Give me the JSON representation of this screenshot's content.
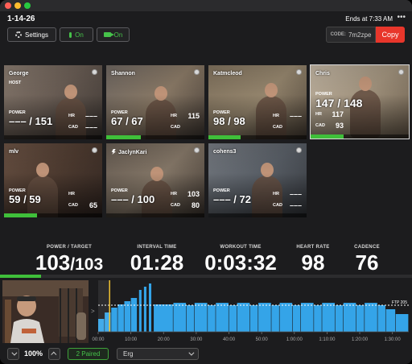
{
  "session": {
    "id": "1-14-26",
    "ends_at": "Ends at 7:33 AM",
    "more_label": "•••"
  },
  "toolbar": {
    "settings_label": "Settings",
    "mic_label": "On",
    "camera_label": "On",
    "code_label": "CODE:",
    "code_value": "7m2zpe",
    "copy_label": "Copy"
  },
  "labels": {
    "power": "POWER",
    "hr": "HR",
    "cad": "CAD",
    "host": "HOST"
  },
  "riders": [
    {
      "name": "George",
      "host": true,
      "power": "––– / 151",
      "hr": "–––",
      "cad": "–––",
      "ftp_bar": 0
    },
    {
      "name": "Shannon",
      "host": false,
      "power": "67 / 67",
      "hr": "115",
      "cad": "",
      "ftp_bar": 0.35
    },
    {
      "name": "Katmcleod",
      "host": false,
      "power": "98 / 98",
      "hr": "–––",
      "cad": "",
      "ftp_bar": 0.33
    },
    {
      "name": "Chris",
      "host": false,
      "power": "147 / 148",
      "hr": "117",
      "cad": "93",
      "ftp_bar": 0.34
    },
    {
      "name": "mlv",
      "host": false,
      "power": "59 / 59",
      "hr": "",
      "cad": "65",
      "ftp_bar": 0.34
    },
    {
      "name": "JaclynKari",
      "host": false,
      "power": "––– / 100",
      "hr": "103",
      "cad": "80",
      "ftp_bar": 0
    },
    {
      "name": "cohens3",
      "host": false,
      "power": "––– / 72",
      "hr": "–––",
      "cad": "–––",
      "ftp_bar": 0
    }
  ],
  "stats": [
    {
      "label": "POWER / TARGET",
      "value": "103",
      "target": "/103"
    },
    {
      "label": "INTERVAL TIME",
      "value": "01:28"
    },
    {
      "label": "WORKOUT TIME",
      "value": "0:03:32"
    },
    {
      "label": "HEART RATE",
      "value": "98"
    },
    {
      "label": "CADENCE",
      "value": "76"
    }
  ],
  "workout_progress": 0.1,
  "chart_data": {
    "type": "bar",
    "ftp_label": "FTP 205",
    "x_ticks": [
      "00:00",
      "10:00",
      "20:00",
      "30:00",
      "40:00",
      "50:00",
      "1:00:00",
      "1:10:00",
      "1:20:00",
      "1:30:00"
    ],
    "current_time_min": 3.5,
    "colors": {
      "bar": "#34a4e8",
      "cursor": "#f1c232",
      "ftp_line": "#ffffff"
    }
  },
  "footer": {
    "zoom": "100%",
    "paired": "2 Paired",
    "mode": "Erg",
    "chart_toggle": ">"
  }
}
